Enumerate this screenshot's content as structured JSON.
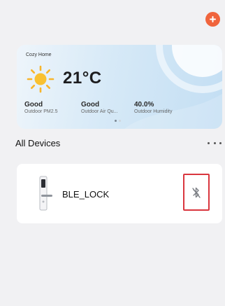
{
  "header": {
    "add_icon": "plus-icon",
    "accent_color": "#f0643c"
  },
  "weather": {
    "home_name": "Cozy Home",
    "icon": "sun-icon",
    "temperature": "21°C",
    "metrics": [
      {
        "value": "Good",
        "label": "Outdoor PM2.5"
      },
      {
        "value": "Good",
        "label": "Outdoor Air Qu..."
      },
      {
        "value": "40.0%",
        "label": "Outdoor Humidity"
      }
    ],
    "page_count": 2,
    "active_page": 1
  },
  "devices": {
    "section_title": "All Devices",
    "more_icon": "more-dots-icon",
    "items": [
      {
        "name": "BLE_LOCK",
        "icon": "smart-lock-icon",
        "status_icon": "bluetooth-disabled-icon",
        "highlight_color": "#d9363e"
      }
    ]
  }
}
